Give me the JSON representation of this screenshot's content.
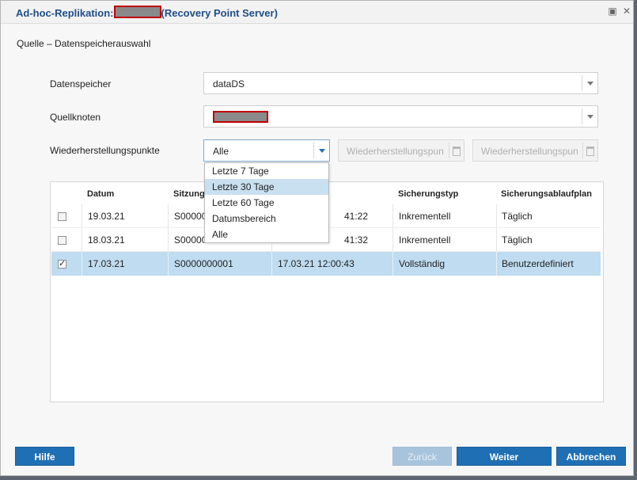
{
  "window": {
    "title_prefix": "Ad-hoc-Replikation:",
    "title_suffix": "(Recovery Point Server)"
  },
  "section_title": "Quelle – Datenspeicherauswahl",
  "form": {
    "datastore_label": "Datenspeicher",
    "datastore_value": "dataDS",
    "source_node_label": "Quellknoten",
    "recovery_points_label": "Wiederherstellungspunkte",
    "recovery_points_value": "Alle",
    "date_from_placeholder": "Wiederherstellungspunkt",
    "date_to_placeholder": "Wiederherstellungspunkt"
  },
  "dropdown": {
    "options": [
      "Letzte 7 Tage",
      "Letzte 30 Tage",
      "Letzte 60 Tage",
      "Datumsbereich",
      "Alle"
    ],
    "highlighted_index": 1
  },
  "table": {
    "headers": [
      "Datum",
      "Sitzung",
      "",
      "Sicherungstyp",
      "Sicherungsablaufplan"
    ],
    "rows": [
      {
        "checked": false,
        "selected": false,
        "date": "19.03.21",
        "session": "S00000",
        "time": "41:22",
        "type": "Inkrementell",
        "schedule": "Täglich"
      },
      {
        "checked": false,
        "selected": false,
        "date": "18.03.21",
        "session": "S00000",
        "time": "41:32",
        "type": "Inkrementell",
        "schedule": "Täglich"
      },
      {
        "checked": true,
        "selected": true,
        "date": "17.03.21",
        "session": "S0000000001",
        "time": "17.03.21 12:00:43",
        "type": "Vollständig",
        "schedule": "Benutzerdefiniert"
      }
    ]
  },
  "buttons": {
    "help": "Hilfe",
    "back": "Zurück",
    "next": "Weiter",
    "cancel": "Abbrechen"
  },
  "colors": {
    "title": "#1f4e86",
    "accent": "#1f6fb5",
    "selected_row": "#bfdcf0",
    "redaction_border": "#c00000"
  }
}
